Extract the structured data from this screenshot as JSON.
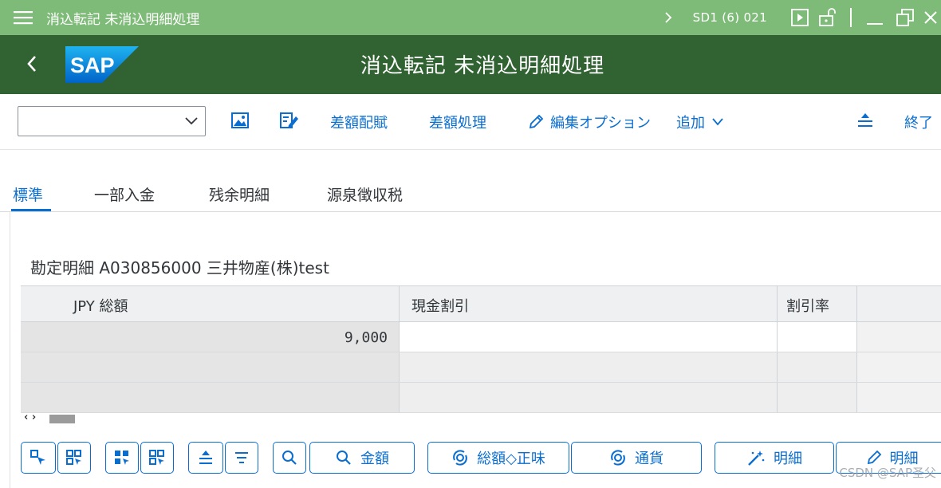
{
  "window": {
    "title": "消込転記 未消込明細処理",
    "system_info": "SD1 (6) 021",
    "icons": [
      "hamburger-icon",
      "chevron-right-icon",
      "play-icon",
      "unlock-icon",
      "minimize-icon",
      "restore-icon",
      "close-icon"
    ]
  },
  "header": {
    "app_title": "消込転記 未消込明細処理",
    "logo_text": "SAP"
  },
  "toolbar": {
    "combo_value": "",
    "diff_postpone": "差額配賦",
    "diff_process": "差額処理",
    "edit_options": "編集オプション",
    "add": "追加",
    "exit": "終了"
  },
  "tabs": [
    {
      "label": "標準",
      "active": true
    },
    {
      "label": "一部入金",
      "active": false
    },
    {
      "label": "残余明細",
      "active": false
    },
    {
      "label": "源泉徴収税",
      "active": false
    }
  ],
  "items": {
    "heading": "勘定明細 A030856000 三井物産(株)test",
    "columns": [
      "JPY 総額",
      "現金割引",
      "割引率"
    ],
    "rows": [
      {
        "gross": "9,000",
        "discount": "",
        "rate": ""
      },
      {
        "gross": "",
        "discount": "",
        "rate": ""
      },
      {
        "gross": "",
        "discount": "",
        "rate": ""
      }
    ]
  },
  "buttons": {
    "amount": "金額",
    "gross_net": "総額◇正味",
    "currency": "通貨",
    "detail1": "明細",
    "detail2": "明細"
  },
  "watermark": "CSDN @SAP圣父",
  "colors": {
    "titlebar": "#7fbb78",
    "shell": "#316232",
    "accent": "#0a6ed1"
  }
}
